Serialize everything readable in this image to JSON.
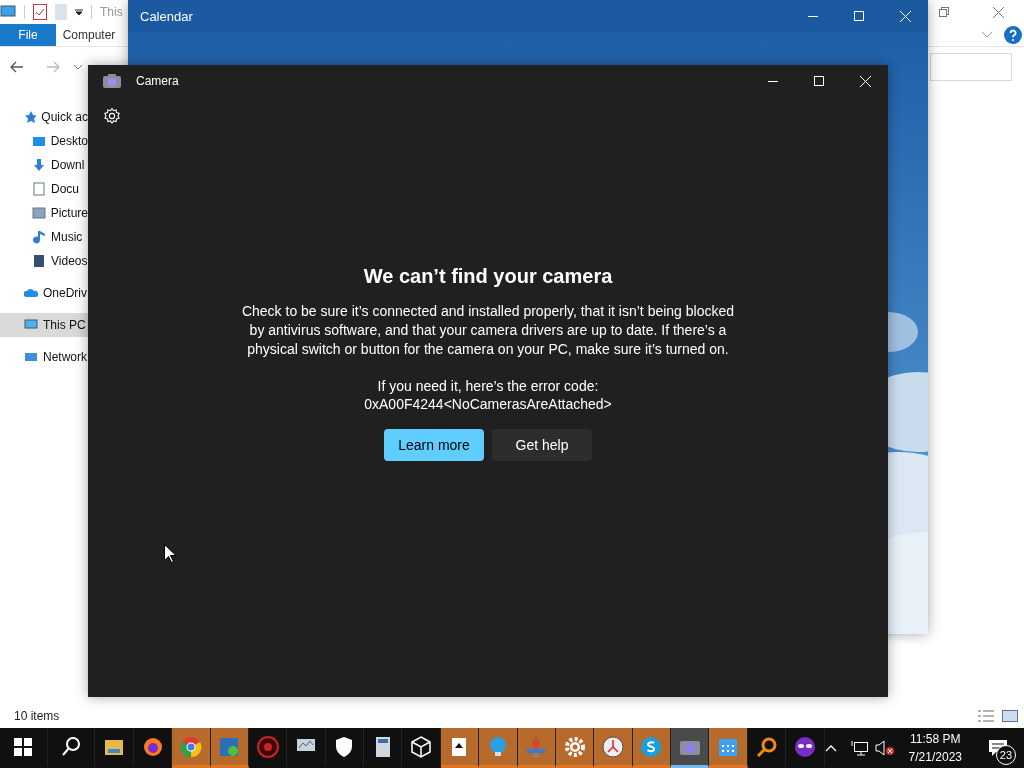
{
  "explorer": {
    "title_fragment": "This",
    "ribbon_tabs": [
      {
        "label": "File",
        "selected": true
      },
      {
        "label": "Computer",
        "selected": false
      }
    ],
    "sidebar": [
      {
        "label": "Quick ac",
        "kind": "star",
        "selected": false
      },
      {
        "label": "Deskto",
        "kind": "desktop",
        "selected": false
      },
      {
        "label": "Downl",
        "kind": "download",
        "selected": false
      },
      {
        "label": "Docu",
        "kind": "document",
        "selected": false
      },
      {
        "label": "Picture",
        "kind": "pictures",
        "selected": false
      },
      {
        "label": "Music",
        "kind": "music",
        "selected": false
      },
      {
        "label": "Videos",
        "kind": "video",
        "selected": false
      },
      {
        "label": "OneDriv",
        "kind": "cloud",
        "selected": false
      },
      {
        "label": "This PC",
        "kind": "pc",
        "selected": true
      },
      {
        "label": "Network",
        "kind": "network",
        "selected": false
      }
    ],
    "status": "10 items"
  },
  "calendar": {
    "title": "Calendar"
  },
  "camera": {
    "title": "Camera",
    "heading": "We can’t find your camera",
    "message": "Check to be sure it’s connected and installed properly, that it isn’t being blocked by antivirus software, and that your camera drivers are up to date. If there’s a physical switch or button for the camera on your PC, make sure it’s turned on.",
    "error_label": "If you need it, here’s the error code:",
    "error_code": "0xA00F4244<NoCamerasAreAttached>",
    "buttons": [
      {
        "label": "Learn more",
        "kind": "primary"
      },
      {
        "label": "Get help",
        "kind": "secondary"
      }
    ]
  },
  "taskbar": {
    "apps": [
      {
        "kind": "start",
        "highlighted": false,
        "selected": false
      },
      {
        "kind": "search",
        "highlighted": false,
        "selected": false
      },
      {
        "kind": "folder",
        "highlighted": false,
        "selected": false
      },
      {
        "kind": "firefox",
        "highlighted": false,
        "selected": false
      },
      {
        "kind": "chrome",
        "highlighted": true,
        "selected": false
      },
      {
        "kind": "bluebox",
        "highlighted": true,
        "selected": false
      },
      {
        "kind": "redgear",
        "highlighted": false,
        "selected": false
      },
      {
        "kind": "monitor",
        "highlighted": false,
        "selected": false
      },
      {
        "kind": "shield",
        "highlighted": false,
        "selected": false
      },
      {
        "kind": "calculator",
        "highlighted": false,
        "selected": false
      },
      {
        "kind": "cube",
        "highlighted": false,
        "selected": false
      },
      {
        "kind": "cards",
        "highlighted": true,
        "selected": false
      },
      {
        "kind": "bulb",
        "highlighted": true,
        "selected": false
      },
      {
        "kind": "tool",
        "highlighted": true,
        "selected": false
      },
      {
        "kind": "gear",
        "highlighted": true,
        "selected": false
      },
      {
        "kind": "clock",
        "highlighted": true,
        "selected": false
      },
      {
        "kind": "skype",
        "highlighted": true,
        "selected": false
      },
      {
        "kind": "camera",
        "highlighted": false,
        "selected": true
      },
      {
        "kind": "calendar",
        "highlighted": true,
        "selected": false
      },
      {
        "kind": "magnifier",
        "highlighted": false,
        "selected": false
      },
      {
        "kind": "mask",
        "highlighted": false,
        "selected": false
      }
    ],
    "time": "11:58 PM",
    "date": "7/21/2023",
    "notifications": "23"
  }
}
